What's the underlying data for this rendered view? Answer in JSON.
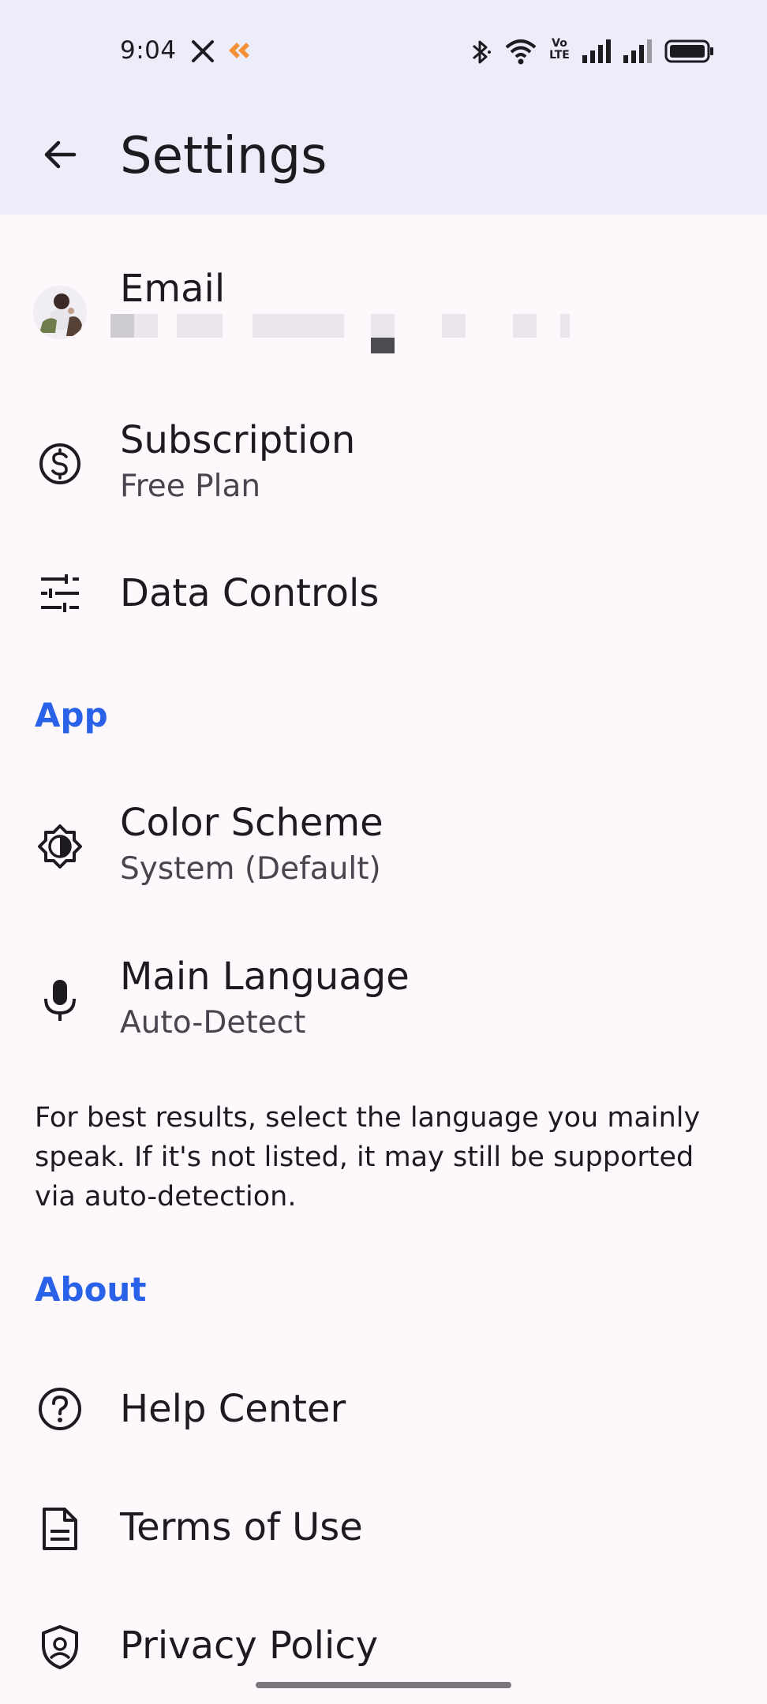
{
  "status_bar": {
    "time": "9:04",
    "icons": [
      "x-app-icon",
      "orange-app-icon",
      "bluetooth-icon",
      "wifi-icon",
      "volte-icon",
      "signal-icon",
      "signal-icon",
      "battery-icon"
    ],
    "volte_label": "Vo LTE"
  },
  "app_bar": {
    "title": "Settings",
    "back_icon": "arrow-back-icon"
  },
  "account": {
    "email_label": "Email"
  },
  "subscription": {
    "title": "Subscription",
    "value": "Free Plan",
    "icon": "dollar-circle-icon"
  },
  "data_controls": {
    "title": "Data Controls",
    "icon": "tune-sliders-icon"
  },
  "section_app": {
    "header": "App"
  },
  "color_scheme": {
    "title": "Color Scheme",
    "value": "System (Default)",
    "icon": "brightness-icon"
  },
  "main_language": {
    "title": "Main Language",
    "value": "Auto-Detect",
    "icon": "microphone-icon"
  },
  "language_helper": "For best results, select the language you mainly speak. If it's not listed, it may still be supported via auto-detection.",
  "section_about": {
    "header": "About"
  },
  "help_center": {
    "title": "Help Center",
    "icon": "help-circle-icon"
  },
  "terms": {
    "title": "Terms of Use",
    "icon": "document-icon"
  },
  "privacy": {
    "title": "Privacy Policy",
    "icon": "shield-icon"
  },
  "colors": {
    "top_bar_bg": "#ecedf9",
    "page_bg": "#fdf8fc",
    "accent": "#2962e8",
    "text_primary": "#1d1b20",
    "text_secondary": "#49454f"
  }
}
